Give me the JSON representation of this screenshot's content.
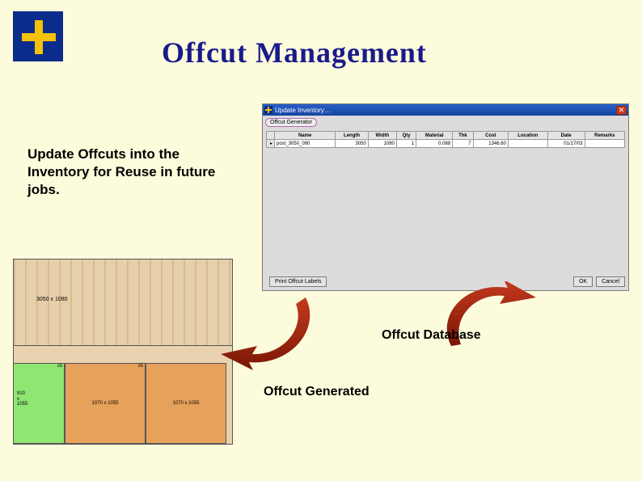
{
  "title": "Offcut Management",
  "description": "Update Offcuts into the Inventory for Reuse in future jobs.",
  "labels": {
    "offcut_generated": "Offcut Generated",
    "offcut_database": "Offcut Database"
  },
  "window": {
    "title": "Update Inventory…",
    "tab": "Offcut Generator",
    "columns": [
      "Name",
      "Length",
      "Width",
      "Qty",
      "Material",
      "Thk",
      "Cost",
      "Location",
      "Date",
      "Remarks"
    ],
    "rows": [
      {
        "name": "post_3050_080",
        "length": "3050",
        "width": "1080",
        "qty": "1",
        "material": "0.088",
        "thk": "7",
        "cost": "1346.60",
        "location": "",
        "date": "01/17/03",
        "remarks": ""
      }
    ],
    "buttons": {
      "print": "Print Offcut Labels",
      "ok": "OK",
      "cancel": "Cancel"
    }
  },
  "layout": {
    "top_label": "3050 x 1080",
    "pieces": [
      {
        "tag": "s5",
        "dim": "910\nx\n1055"
      },
      {
        "tag": "s5",
        "dim": "1070 x 1055"
      },
      {
        "tag": "",
        "dim": "1070 x 1055"
      }
    ]
  }
}
